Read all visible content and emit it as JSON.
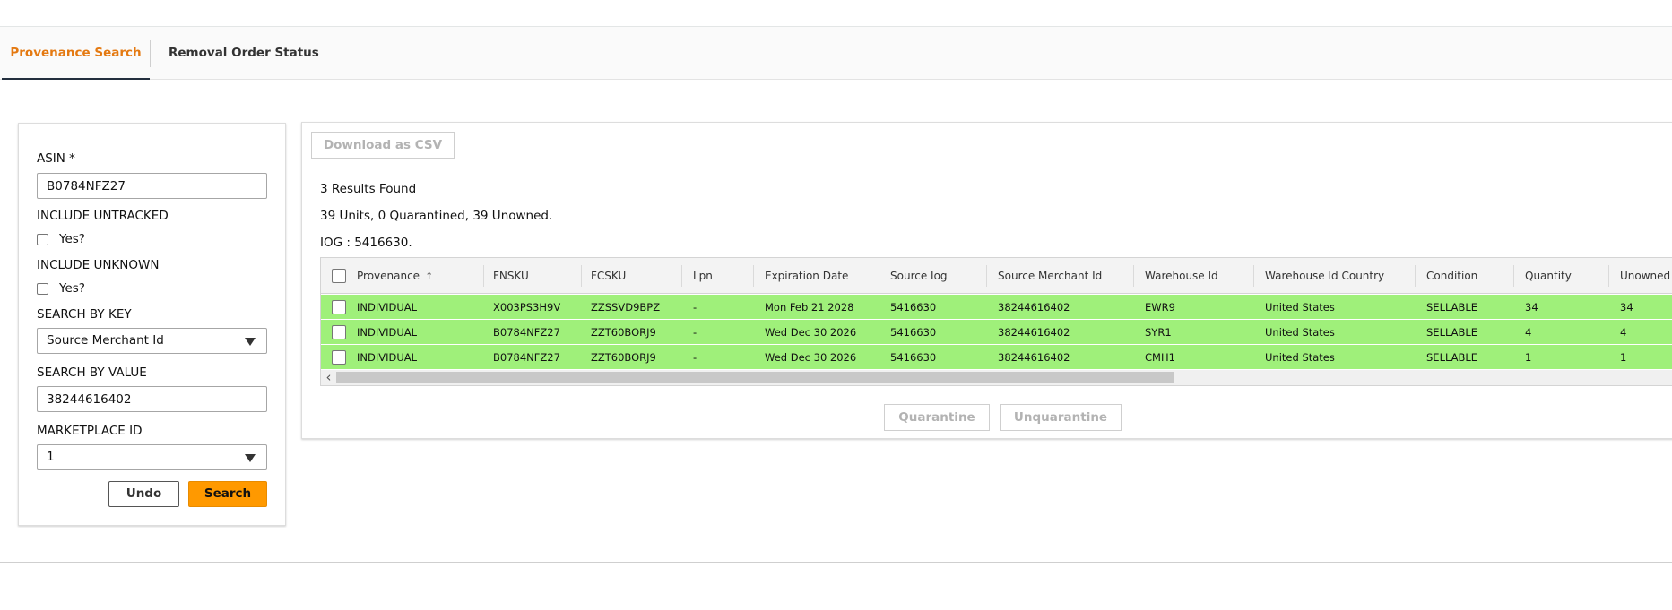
{
  "tabs": {
    "provenance_search": "Provenance Search",
    "removal_order_status": "Removal Order Status"
  },
  "search": {
    "asin_label": "ASIN *",
    "asin_value": "B0784NFZ27",
    "include_untracked_label": "INCLUDE UNTRACKED",
    "include_untracked_option": "Yes?",
    "include_unknown_label": "INCLUDE UNKNOWN",
    "include_unknown_option": "Yes?",
    "search_by_key_label": "SEARCH BY KEY",
    "search_by_key_value": "Source Merchant Id",
    "search_by_value_label": "SEARCH BY VALUE",
    "search_by_value_value": "38244616402",
    "marketplace_label": "MARKETPLACE ID",
    "marketplace_value": "1",
    "undo_label": "Undo",
    "search_label": "Search"
  },
  "results": {
    "download_label": "Download as CSV",
    "results_found": "3 Results Found",
    "units_summary": "39 Units, 0 Quarantined, 39 Unowned.",
    "iog": "IOG : 5416630.",
    "quarantine_label": "Quarantine",
    "unquarantine_label": "Unquarantine"
  },
  "table": {
    "headers": [
      "Provenance",
      "FNSKU",
      "FCSKU",
      "Lpn",
      "Expiration Date",
      "Source Iog",
      "Source Merchant Id",
      "Warehouse Id",
      "Warehouse Id Country",
      "Condition",
      "Quantity",
      "Unowned Q"
    ],
    "sort_arrow": "↑",
    "rows": [
      [
        "INDIVIDUAL",
        "X003PS3H9V",
        "ZZSSVD9BPZ",
        "-",
        "Mon Feb 21 2028",
        "5416630",
        "38244616402",
        "EWR9",
        "United States",
        "SELLABLE",
        "34",
        "34"
      ],
      [
        "INDIVIDUAL",
        "B0784NFZ27",
        "ZZT60BORJ9",
        "-",
        "Wed Dec 30 2026",
        "5416630",
        "38244616402",
        "SYR1",
        "United States",
        "SELLABLE",
        "4",
        "4"
      ],
      [
        "INDIVIDUAL",
        "B0784NFZ27",
        "ZZT60BORJ9",
        "-",
        "Wed Dec 30 2026",
        "5416630",
        "38244616402",
        "CMH1",
        "United States",
        "SELLABLE",
        "1",
        "1"
      ]
    ],
    "row_highlight_color": "#9ff07a",
    "scroll_left_icon": "‹"
  },
  "colors": {
    "accent_tab": "#e47911",
    "primary_button": "#ff9900"
  }
}
